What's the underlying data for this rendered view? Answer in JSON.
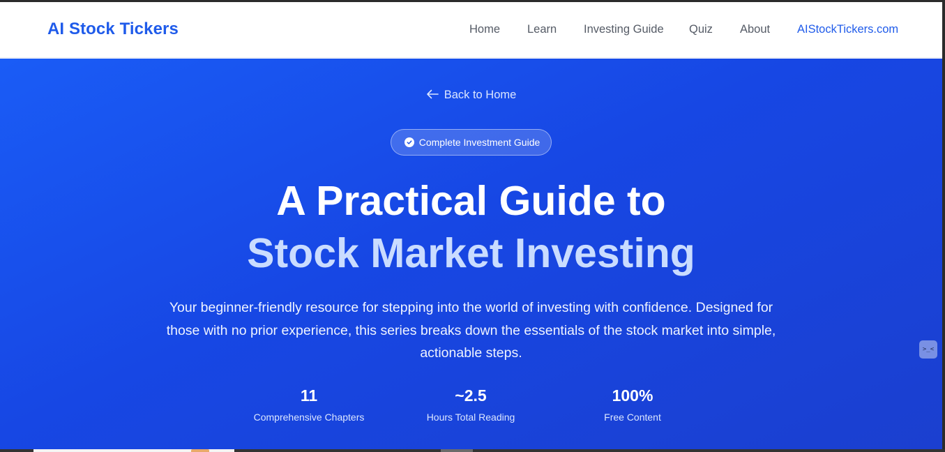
{
  "nav": {
    "brand": "AI Stock Tickers",
    "links": [
      {
        "label": "Home"
      },
      {
        "label": "Learn"
      },
      {
        "label": "Investing Guide"
      },
      {
        "label": "Quiz"
      },
      {
        "label": "About"
      },
      {
        "label": "AIStockTickers.com"
      }
    ]
  },
  "hero": {
    "back_label": "Back to Home",
    "badge": "Complete Investment Guide",
    "title_line1": "A Practical Guide to",
    "title_line2": "Stock Market Investing",
    "description": "Your beginner-friendly resource for stepping into the world of investing with confidence. Designed for those with no prior experience, this series breaks down the essentials of the stock market into simple, actionable steps.",
    "stats": [
      {
        "value": "11",
        "label": "Comprehensive Chapters"
      },
      {
        "value": "~2.5",
        "label": "Hours Total Reading"
      },
      {
        "value": "100%",
        "label": "Free Content"
      }
    ]
  },
  "side_button_glyph": ">_<",
  "colors": {
    "brand": "#1f5bea",
    "hero_start": "#1a5cf6",
    "hero_end": "#1b3fcf",
    "title_accent": "#c9dcff"
  },
  "icons": {
    "back": "arrow-left-icon",
    "badge": "check-circle-icon",
    "side": "terminal-face-icon"
  }
}
